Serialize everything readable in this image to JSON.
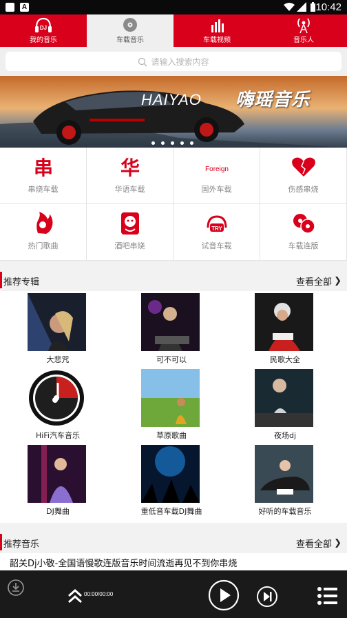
{
  "status_bar": {
    "time": "10:42",
    "badge": "A"
  },
  "tabs": [
    {
      "label": "我的音乐",
      "icon": "dj-headphones-icon",
      "active": false
    },
    {
      "label": "车载音乐",
      "icon": "disc-icon",
      "active": true
    },
    {
      "label": "车载视频",
      "icon": "bar-chart-icon",
      "active": false
    },
    {
      "label": "音乐人",
      "icon": "broadcast-icon",
      "active": false
    }
  ],
  "search": {
    "placeholder": "请输入搜索内容"
  },
  "banner": {
    "brand": "HAIYAO",
    "text": "嗨瑶音乐",
    "dot_count": 5
  },
  "categories": [
    {
      "label": "串烧车载",
      "icon": "chuan-icon"
    },
    {
      "label": "华语车载",
      "icon": "hua-icon"
    },
    {
      "label": "国外车载",
      "icon": "foreign-icon",
      "icon_text": "Foreign"
    },
    {
      "label": "伤感串烧",
      "icon": "broken-heart-icon"
    },
    {
      "label": "热门歌曲",
      "icon": "fire-head-icon"
    },
    {
      "label": "酒吧串烧",
      "icon": "bar-face-icon"
    },
    {
      "label": "试音车载",
      "icon": "try-headphones-icon",
      "icon_text": "TRY"
    },
    {
      "label": "车载连版",
      "icon": "double-disc-icon"
    }
  ],
  "recommend_albums": {
    "title": "推荐专辑",
    "more": "查看全部",
    "items": [
      {
        "label": "大悲咒"
      },
      {
        "label": "可不可以"
      },
      {
        "label": "民歌大全"
      },
      {
        "label": "HiFi汽车音乐"
      },
      {
        "label": "草原歌曲"
      },
      {
        "label": "夜场dj"
      },
      {
        "label": "DJ舞曲"
      },
      {
        "label": "重低音车载DJ舞曲"
      },
      {
        "label": "好听的车载音乐"
      }
    ]
  },
  "recommend_music": {
    "title": "推荐音乐",
    "more": "查看全部",
    "first_song": "韶关Dj小敬-全国语慢歌连版音乐时间流逝再见不到你串烧"
  },
  "player": {
    "time": "00:00/00:00"
  },
  "colors": {
    "accent": "#d9001b",
    "player_bg": "#1a1a1a"
  }
}
